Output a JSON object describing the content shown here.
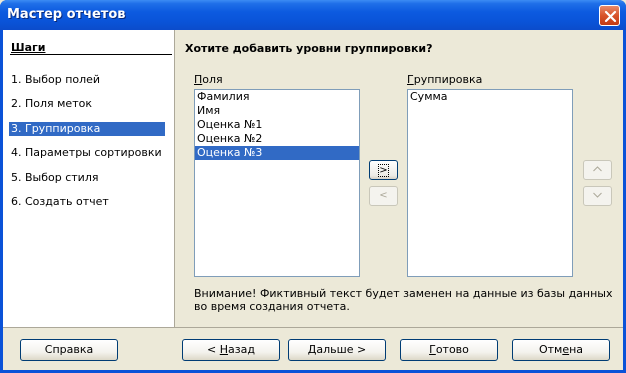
{
  "window": {
    "title": "Мастер отчетов"
  },
  "steps": {
    "title": "Шаги",
    "items": [
      {
        "label": "1. Выбор полей"
      },
      {
        "label": "2. Поля меток"
      },
      {
        "label": "3. Группировка"
      },
      {
        "label": "4. Параметры сортировки"
      },
      {
        "label": "5. Выбор стиля"
      },
      {
        "label": "6. Создать отчет"
      }
    ],
    "active_index": 2
  },
  "main": {
    "question": "Хотите добавить уровни группировки?",
    "fields_label": "Поля",
    "fields": [
      "Фамилия",
      "Имя",
      "Оценка №1",
      "Оценка №2",
      "Оценка №3"
    ],
    "fields_selected": "Оценка №3",
    "grouping_label": "Группировка",
    "grouping": [
      "Сумма"
    ],
    "add_button": ">",
    "remove_button": "<",
    "up_button": "^",
    "down_button": "v",
    "notice": "Внимание! Фиктивный текст будет заменен на данные из базы данных во время создания отчета."
  },
  "buttons": {
    "help": "Справка",
    "back": "< Назад",
    "next": "Дальше >",
    "finish": "Готово",
    "cancel": "Отмена"
  }
}
